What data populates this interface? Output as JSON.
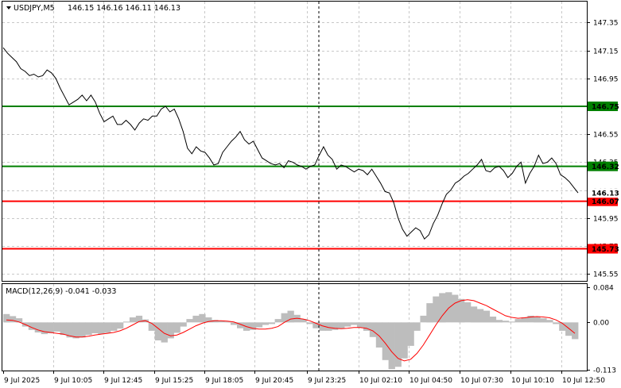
{
  "chart_data": [
    {
      "type": "line",
      "symbol_label": "USDJPY,M5",
      "ohlc": "146.15 146.16 146.11 146.13",
      "ylim": [
        145.5,
        147.5
      ],
      "y_ticks": [
        "147.35",
        "147.15",
        "146.95",
        "146.75",
        "146.55",
        "146.35",
        "146.15",
        "145.95",
        "145.75",
        "145.55"
      ],
      "grid": true,
      "current_price": "146.13",
      "levels": [
        {
          "value": 146.75,
          "label": "146.75",
          "color": "#008000"
        },
        {
          "value": 146.32,
          "label": "146.32",
          "color": "#008000"
        },
        {
          "value": 146.07,
          "label": "146.07",
          "color": "#ff0000"
        },
        {
          "value": 145.73,
          "label": "145.73",
          "color": "#ff0000"
        }
      ],
      "series": [
        {
          "values": [
            147.17,
            147.13,
            147.1,
            147.07,
            147.02,
            147.0,
            146.97,
            146.98,
            146.96,
            146.97,
            147.01,
            146.99,
            146.95,
            146.88,
            146.82,
            146.76,
            146.78,
            146.8,
            146.83,
            146.79,
            146.83,
            146.78,
            146.7,
            146.64,
            146.66,
            146.68,
            146.62,
            146.62,
            146.65,
            146.62,
            146.58,
            146.63,
            146.66,
            146.65,
            146.68,
            146.68,
            146.73,
            146.75,
            146.71,
            146.73,
            146.66,
            146.57,
            146.45,
            146.41,
            146.46,
            146.43,
            146.42,
            146.38,
            146.33,
            146.34,
            146.42,
            146.46,
            146.5,
            146.53,
            146.57,
            146.51,
            146.48,
            146.5,
            146.44,
            146.38,
            146.36,
            146.34,
            146.33,
            146.34,
            146.31,
            146.36,
            146.35,
            146.33,
            146.32,
            146.3,
            146.32,
            146.33,
            146.4,
            146.46,
            146.4,
            146.37,
            146.3,
            146.33,
            146.32,
            146.3,
            146.28,
            146.3,
            146.29,
            146.26,
            146.3,
            146.25,
            146.2,
            146.14,
            146.13,
            146.06,
            145.95,
            145.87,
            145.82,
            145.85,
            145.88,
            145.86,
            145.8,
            145.83,
            145.91,
            145.97,
            146.05,
            146.12,
            146.15,
            146.2,
            146.22,
            146.25,
            146.27,
            146.3,
            146.33,
            146.37,
            146.29,
            146.28,
            146.31,
            146.32,
            146.29,
            146.24,
            146.27,
            146.32,
            146.35,
            146.2,
            146.27,
            146.32,
            146.4,
            146.34,
            146.35,
            146.38,
            146.34,
            146.26,
            146.24,
            146.21,
            146.17,
            146.13
          ],
          "color": "#000000"
        }
      ]
    },
    {
      "type": "bar",
      "indicator_label": "MACD(12,26,9) -0.041 -0.033",
      "ylim": [
        -0.113,
        0.084
      ],
      "y_ticks": [
        "0.084",
        "0.00",
        "-0.113"
      ],
      "histogram": [
        0.02,
        0.015,
        0.01,
        -0.01,
        -0.018,
        -0.024,
        -0.028,
        -0.026,
        -0.022,
        -0.03,
        -0.036,
        -0.038,
        -0.036,
        -0.03,
        -0.026,
        -0.028,
        -0.025,
        -0.02,
        -0.015,
        0.002,
        0.012,
        0.016,
        0.007,
        -0.02,
        -0.043,
        -0.048,
        -0.038,
        -0.025,
        -0.01,
        0.008,
        0.016,
        0.02,
        0.012,
        0.006,
        0.004,
        0.002,
        -0.006,
        -0.014,
        -0.02,
        -0.018,
        -0.012,
        -0.006,
        -0.004,
        0.008,
        0.022,
        0.028,
        0.018,
        0.008,
        -0.004,
        -0.014,
        -0.02,
        -0.02,
        -0.018,
        -0.015,
        -0.01,
        -0.006,
        -0.012,
        -0.02,
        -0.035,
        -0.06,
        -0.09,
        -0.112,
        -0.106,
        -0.086,
        -0.056,
        -0.02,
        0.016,
        0.046,
        0.062,
        0.07,
        0.072,
        0.066,
        0.056,
        0.048,
        0.038,
        0.032,
        0.028,
        0.014,
        0.006,
        0.004,
        0.002,
        0.008,
        0.012,
        0.016,
        0.014,
        0.01,
        0.006,
        -0.004,
        -0.02,
        -0.032,
        -0.04
      ],
      "signal": [
        0.006,
        0.005,
        0.001,
        -0.005,
        -0.012,
        -0.018,
        -0.022,
        -0.024,
        -0.026,
        -0.028,
        -0.032,
        -0.035,
        -0.035,
        -0.033,
        -0.03,
        -0.028,
        -0.026,
        -0.024,
        -0.02,
        -0.014,
        -0.006,
        0.002,
        0.004,
        -0.002,
        -0.014,
        -0.026,
        -0.032,
        -0.03,
        -0.024,
        -0.016,
        -0.008,
        -0.002,
        0.002,
        0.004,
        0.004,
        0.003,
        0.001,
        -0.004,
        -0.01,
        -0.014,
        -0.016,
        -0.016,
        -0.014,
        -0.01,
        0.0,
        0.008,
        0.01,
        0.008,
        0.004,
        -0.002,
        -0.008,
        -0.012,
        -0.014,
        -0.015,
        -0.014,
        -0.012,
        -0.012,
        -0.014,
        -0.02,
        -0.032,
        -0.05,
        -0.07,
        -0.086,
        -0.092,
        -0.088,
        -0.074,
        -0.054,
        -0.03,
        -0.006,
        0.016,
        0.034,
        0.046,
        0.052,
        0.054,
        0.052,
        0.046,
        0.04,
        0.032,
        0.024,
        0.016,
        0.012,
        0.01,
        0.011,
        0.013,
        0.014,
        0.013,
        0.011,
        0.006,
        -0.002,
        -0.014,
        -0.026
      ],
      "histogram_color": "#bdbdbd",
      "signal_color": "#ff0000"
    }
  ],
  "time_labels": [
    "9 Jul 2025",
    "9 Jul 10:05",
    "9 Jul 12:45",
    "9 Jul 15:25",
    "9 Jul 18:05",
    "9 Jul 20:45",
    "9 Jul 23:25",
    "10 Jul 02:10",
    "10 Jul 04:50",
    "10 Jul 07:30",
    "10 Jul 10:10",
    "10 Jul 12:50"
  ]
}
